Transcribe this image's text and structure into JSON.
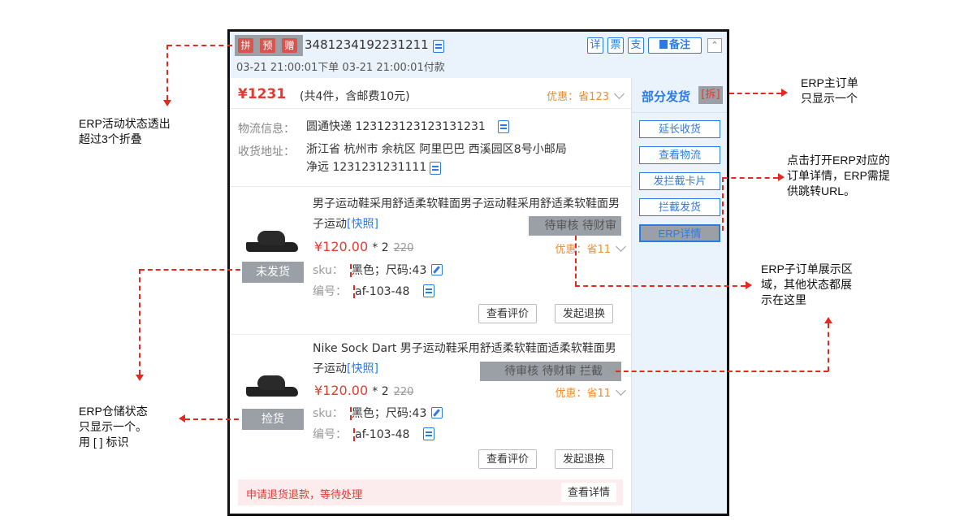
{
  "header": {
    "tags": [
      "拼",
      "预",
      "赠"
    ],
    "order_no": "3481234192231211",
    "times": "03-21 21:00:01下单    03-21 21:00:01付款",
    "btn_detail": "详",
    "btn_invoice": "票",
    "btn_pay": "支",
    "btn_note": "备注",
    "collapse": "^"
  },
  "summary": {
    "price": "¥1231",
    "count": "(共4件，含邮费10元)",
    "discount": "优惠：省123"
  },
  "right": {
    "status": "部分发货",
    "split": "[拆]",
    "buttons": [
      "延长收货",
      "查看物流",
      "发拦截卡片",
      "拦截发货",
      "ERP详情"
    ]
  },
  "logistics": {
    "label": "物流信息：",
    "value": "圆通快递 123123123123131231",
    "addr_label": "收货地址：",
    "addr_line1": "浙江省 杭州市 余杭区 阿里巴巴 西溪园区8号小邮局",
    "addr_line2": "净远 1231231231111"
  },
  "items": [
    {
      "title": "男子运动鞋采用舒适柔软鞋面男子运动鞋采用舒适柔软鞋面男子运动",
      "snapshot": "[快照]",
      "erp_status": "待审核 待财审",
      "price": "¥120.00",
      "qty": "* 2",
      "orig": "220",
      "discount": "优惠：省11",
      "sku_label": "sku：",
      "sku": "黑色；尺码:43",
      "code_label": "编号：",
      "code": "af-103-48",
      "warehouse": "未发货",
      "btn_review": "查看评价",
      "btn_return": "发起退换"
    },
    {
      "title": "Nike Sock Dart 男子运动鞋采用舒适柔软鞋面适柔软鞋面男子运动",
      "snapshot": "[快照]",
      "erp_status": "待审核 待财审 拦截",
      "price": "¥120.00",
      "qty": "* 2",
      "orig": "220",
      "discount": "优惠：省11",
      "sku_label": "sku：",
      "sku": "黑色；尺码:43",
      "code_label": "编号：",
      "code": "af-103-48",
      "warehouse": "捡货",
      "btn_review": "查看评价",
      "btn_return": "发起退换"
    }
  ],
  "refund": {
    "text": "申请退货退款，等待处理",
    "btn": "查看详情"
  },
  "annotations": {
    "activity": [
      "ERP活动状态透出",
      "超过3个折叠"
    ],
    "main_order": [
      "ERP主订单",
      "只显示一个"
    ],
    "erp_link": [
      "点击打开ERP对应的",
      "订单详情，ERP需提",
      "供跳转URL。"
    ],
    "sub_order": [
      "ERP子订单展示区",
      "域，其他状态都展",
      "示在这里"
    ],
    "warehouse": [
      "ERP仓储状态",
      "只显示一个。",
      "用 [ ] 标识"
    ]
  },
  "colors": {
    "accent": "#2c7be5",
    "price": "#e03c31",
    "discount": "#f08c2c",
    "annotation": "#e02b20",
    "highlight_box": "#9aa0a6"
  }
}
